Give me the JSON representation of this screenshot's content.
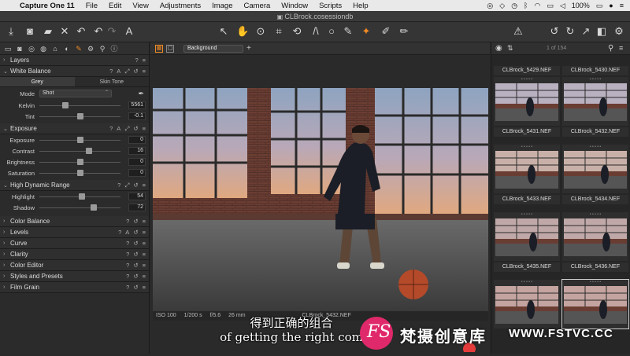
{
  "menubar": {
    "app": "Capture One 11",
    "items": [
      "File",
      "Edit",
      "View",
      "Adjustments",
      "Image",
      "Camera",
      "Window",
      "Scripts",
      "Help"
    ],
    "battery": "100%"
  },
  "window": {
    "title": "CLBrock.cosessiondb"
  },
  "left_panel": {
    "layers": "Layers",
    "white_balance": {
      "title": "White Balance",
      "tabs": [
        "Grey",
        "Skin Tone"
      ],
      "mode_label": "Mode",
      "mode_value": "Shot",
      "kelvin_label": "Kelvin",
      "kelvin_value": "5561",
      "tint_label": "Tint",
      "tint_value": "-0.1"
    },
    "exposure": {
      "title": "Exposure",
      "rows": [
        {
          "label": "Exposure",
          "value": "0"
        },
        {
          "label": "Contrast",
          "value": "16"
        },
        {
          "label": "Brightness",
          "value": "0"
        },
        {
          "label": "Saturation",
          "value": "0"
        }
      ]
    },
    "hdr": {
      "title": "High Dynamic Range",
      "rows": [
        {
          "label": "Highlight",
          "value": "54"
        },
        {
          "label": "Shadow",
          "value": "72"
        }
      ]
    },
    "collapsed_tools": [
      "Color Balance",
      "Levels",
      "Curve",
      "Clarity",
      "Color Editor",
      "Styles and Presets",
      "Film Grain"
    ]
  },
  "viewer": {
    "background": "Background",
    "exif": {
      "iso": "ISO 100",
      "shutter": "1/200 s",
      "aperture": "f/5.6",
      "focal": "26 mm",
      "filename": "CLBrock_5432.NEF"
    }
  },
  "browser": {
    "count": "1 of 154",
    "thumbnails": [
      "CLBrock_5429.NEF",
      "CLBrock_5430.NEF",
      "CLBrock_5431.NEF",
      "CLBrock_5432.NEF",
      "CLBrock_5433.NEF",
      "CLBrock_5434.NEF",
      "CLBrock_5435.NEF",
      "CLBrock_5436.NEF"
    ]
  },
  "subtitles": {
    "cn": "得到正确的组合",
    "en": "of getting the right com"
  },
  "watermark": {
    "text": "梵摄创意库",
    "url": "WWW.FSTVC.CC",
    "logo": "FS"
  }
}
